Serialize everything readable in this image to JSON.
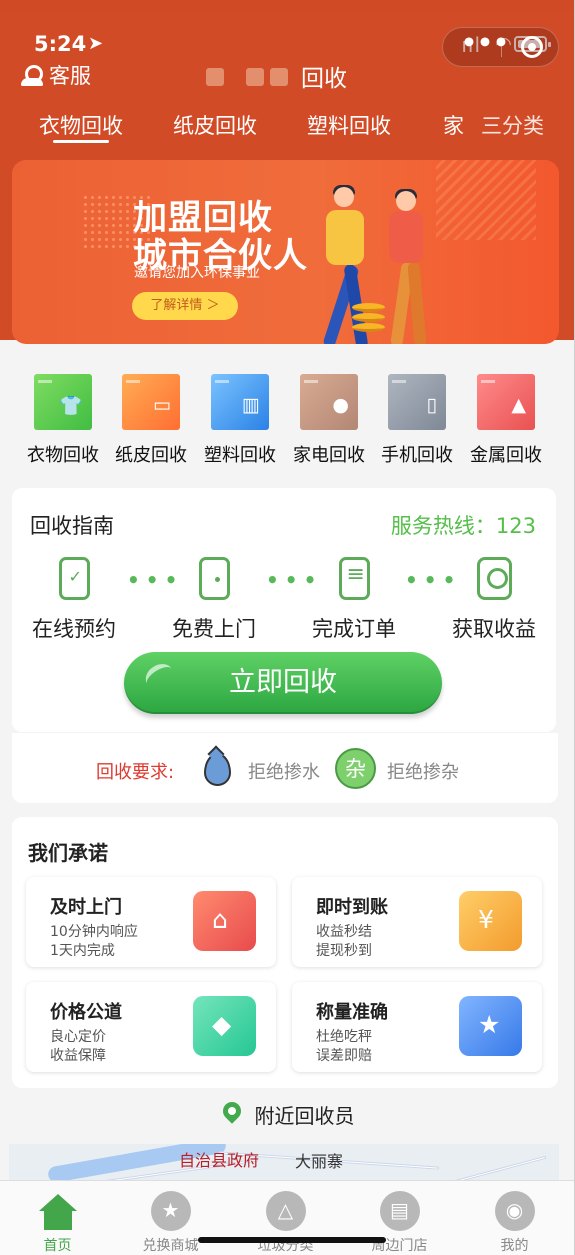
{
  "status": {
    "time": "5:24",
    "location_arrow": "➤",
    "signal": "ııl"
  },
  "topbar": {
    "service": "客服",
    "title": "回收"
  },
  "tabs": [
    {
      "label": "衣物回收",
      "active": true
    },
    {
      "label": "纸皮回收"
    },
    {
      "label": "塑料回收"
    },
    {
      "label": "家"
    },
    {
      "label": "三分类"
    }
  ],
  "banner": {
    "line1": "加盟回收",
    "line2": "城市合伙人",
    "subtitle": "邀请您加入环保事业",
    "button": "了解详情 ＞"
  },
  "categories": [
    {
      "label": "衣物回收",
      "glyph": "👕",
      "color": "#53c545"
    },
    {
      "label": "纸皮回收",
      "glyph": "▭",
      "color": "#ff7b3a"
    },
    {
      "label": "塑料回收",
      "glyph": "▥",
      "color": "#2b8ee8"
    },
    {
      "label": "家电回收",
      "glyph": "●",
      "color": "#c7947f"
    },
    {
      "label": "手机回收",
      "glyph": "▯",
      "color": "#8f9aa9"
    },
    {
      "label": "金属回收",
      "glyph": "▲",
      "color": "#f05d5e"
    }
  ],
  "guide": {
    "title": "回收指南",
    "hotline_label": "服务热线：",
    "hotline_number": "123",
    "steps": [
      "在线预约",
      "免费上门",
      "完成订单",
      "获取收益"
    ],
    "button": "立即回收"
  },
  "requirements": {
    "label": "回收要求:",
    "water": "拒绝掺水",
    "mix_icon": "杂",
    "mixed": "拒绝掺杂"
  },
  "promise": {
    "title": "我们承诺",
    "cards": [
      {
        "title": "及时上门",
        "line1": "10分钟内响应",
        "line2": "1天内完成",
        "icon": "house-icon"
      },
      {
        "title": "即时到账",
        "line1": "收益秒结",
        "line2": "提现秒到",
        "icon": "money-bag-icon"
      },
      {
        "title": "价格公道",
        "line1": "良心定价",
        "line2": "收益保障",
        "icon": "coin-icon"
      },
      {
        "title": "称量准确",
        "line1": "杜绝吃秤",
        "line2": "误差即赔",
        "icon": "shield-star-icon"
      }
    ]
  },
  "nearby": {
    "label": "附近回收员"
  },
  "map": {
    "label1": "自治县政府",
    "label2": "大丽寨"
  },
  "bottom_nav": [
    {
      "label": "首页",
      "active": true
    },
    {
      "label": "兑换商城"
    },
    {
      "label": "垃圾分类"
    },
    {
      "label": "周边门店"
    },
    {
      "label": "我的"
    }
  ],
  "colors": {
    "header": "#d24b27",
    "accent_green": "#55bf4a",
    "button_green": "#2ca641",
    "requirement_red": "#df3b31"
  }
}
